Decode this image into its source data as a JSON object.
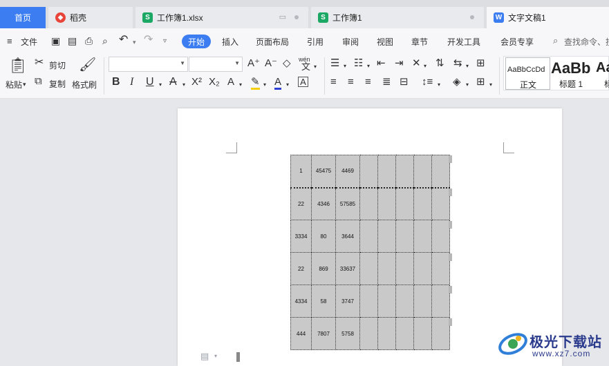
{
  "tabs": {
    "home": "首页",
    "docer": "稻壳",
    "xlsx": "工作簿1.xlsx",
    "workbook": "工作簿1",
    "document": "文字文稿1"
  },
  "menu": {
    "file": "文件",
    "start": "开始",
    "insert": "插入",
    "layout": "页面布局",
    "reference": "引用",
    "review": "审阅",
    "view": "视图",
    "chapter": "章节",
    "devtools": "开发工具",
    "vip": "会员专享",
    "search_placeholder": "查找命令、搜"
  },
  "toolbar": {
    "paste": "粘贴",
    "cut": "剪切",
    "copy": "复制",
    "format_painter": "格式刷",
    "font_name": "",
    "font_size": "",
    "wen_label": "wén"
  },
  "styles": [
    {
      "preview": "AaBbCcDd",
      "name": "正文"
    },
    {
      "preview": "AaBb",
      "name": "标题 1"
    },
    {
      "preview": "Aa",
      "name": "标"
    }
  ],
  "table": {
    "rows": [
      [
        "1",
        "45475",
        "4469",
        "",
        "",
        "",
        "",
        ""
      ],
      [
        "22",
        "4346",
        "57585",
        "",
        "",
        "",
        "",
        ""
      ],
      [
        "3334",
        "80",
        "3644",
        "",
        "",
        "",
        "",
        ""
      ],
      [
        "22",
        "869",
        "33637",
        "",
        "",
        "",
        "",
        ""
      ],
      [
        "4334",
        "58",
        "3747",
        "",
        "",
        "",
        "",
        ""
      ],
      [
        "444",
        "7807",
        "5758",
        "",
        "",
        "",
        "",
        ""
      ]
    ]
  },
  "watermark": {
    "title": "极光下载站",
    "url": "www.xz7.com"
  },
  "colors": {
    "accent": "#3c7ef2",
    "table_fill": "#c9c9c9",
    "sheet_icon": "#1aa864",
    "doc_icon": "#3c7ef2",
    "docer_icon": "#e8443a"
  }
}
